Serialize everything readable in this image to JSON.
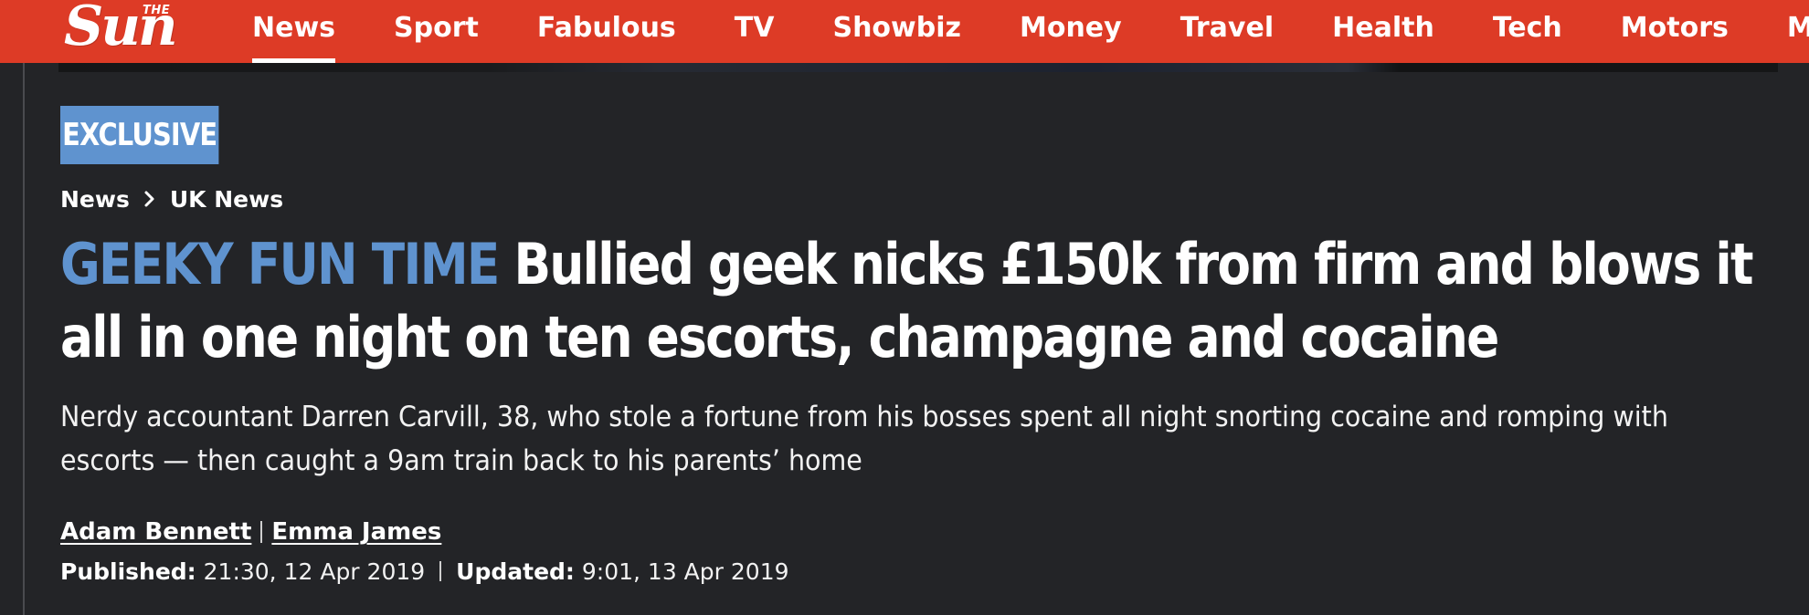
{
  "brand": {
    "logo_small": "THE",
    "logo_main": "Sun",
    "accent_color": "#dd3b26",
    "kicker_color": "#5f93cf"
  },
  "nav": {
    "items": [
      {
        "label": "News",
        "active": true
      },
      {
        "label": "Sport"
      },
      {
        "label": "Fabulous"
      },
      {
        "label": "TV"
      },
      {
        "label": "Showbiz"
      },
      {
        "label": "Money"
      },
      {
        "label": "Travel"
      },
      {
        "label": "Health"
      },
      {
        "label": "Tech"
      },
      {
        "label": "Motors"
      },
      {
        "label": "More"
      }
    ]
  },
  "article": {
    "badge": "EXCLUSIVE",
    "breadcrumb": [
      "News",
      "UK News"
    ],
    "kicker": "GEEKY FUN TIME",
    "headline": "Bullied geek nicks £150k from firm and blows it all in one night on ten escorts, champagne and cocaine",
    "standfirst": "Nerdy accountant Darren Carvill, 38, who stole a fortune from his bosses spent all night snorting cocaine and romping with escorts — then caught a 9am train back to his parents’ home",
    "authors": [
      "Adam Bennett",
      "Emma James"
    ],
    "published_label": "Published:",
    "published_value": "21:30, 12 Apr 2019",
    "updated_label": "Updated:",
    "updated_value": "9:01, 13 Apr 2019"
  }
}
